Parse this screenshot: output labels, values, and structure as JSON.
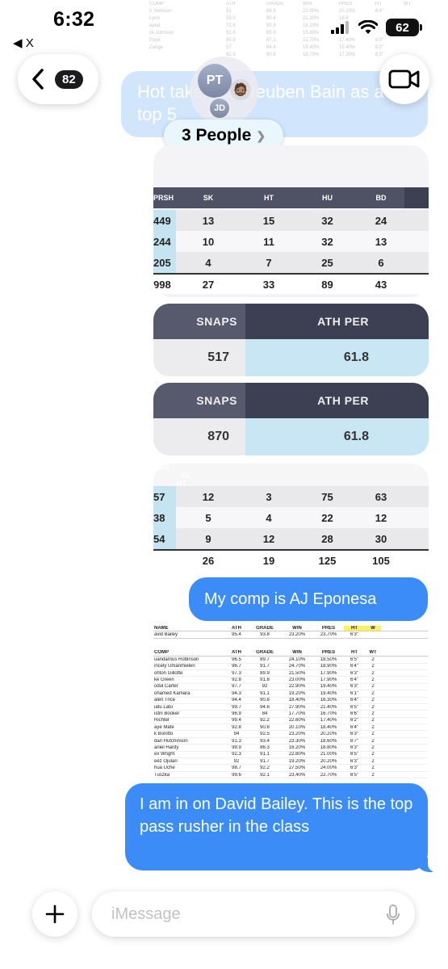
{
  "status_bar": {
    "time": "6:32",
    "back_app": "◀ X",
    "battery": "62"
  },
  "bg_sheet": {
    "header": [
      "COMP",
      "ATH",
      "GRADE",
      "WIN",
      "PRES",
      "HT",
      "WT"
    ],
    "rows": [
      [
        "n Swinson",
        "91",
        "86.3",
        "22.00%",
        "20.10%",
        "6'4\""
      ],
      [
        "Lynn",
        "59.9",
        "90.4",
        "21.30%",
        "18.6",
        ""
      ],
      [
        "ayed",
        "72.8",
        "90.9",
        "16.20%",
        "18.",
        ""
      ],
      [
        "ck Johnson",
        "51.6",
        "85.9",
        "15.80%",
        "",
        ""
      ],
      [
        "Paye",
        "85.9",
        "87.1",
        "21.70%",
        "17.40%",
        "6'3\""
      ],
      [
        "Zarige",
        "57",
        "84.4",
        "18.40%",
        "15.40%",
        "6'2\""
      ],
      [
        "",
        "82.3",
        "90.8",
        "18.70%",
        "17.30%",
        "6'3\""
      ]
    ]
  },
  "nav": {
    "back_count": "82",
    "group_initials_1": "PT",
    "group_initials_2": "JD",
    "group_emoji": "🧔🏽",
    "people_label": "3 People"
  },
  "faded_message": "Hot take... of Reuben Bain as a top 5",
  "stat_table_1": {
    "columns": [
      "PRSH",
      "SK",
      "HT",
      "HU",
      "BD"
    ],
    "rows": [
      [
        "449",
        "13",
        "15",
        "32",
        "24"
      ],
      [
        "244",
        "10",
        "11",
        "32",
        "13"
      ],
      [
        "205",
        "4",
        "7",
        "25",
        "6"
      ],
      [
        "998",
        "27",
        "33",
        "89",
        "43"
      ]
    ]
  },
  "snap_card_1": {
    "snaps_label": "SNAPS",
    "ath_label": "ATH PER",
    "snaps": "517",
    "ath": "61.8"
  },
  "snap_card_2": {
    "snaps_label": "SNAPS",
    "ath_label": "ATH PER",
    "snaps": "870",
    "ath": "61.8"
  },
  "stat_table_2": {
    "columns": [
      "RSH",
      "SK",
      "HT",
      "HU",
      "BD"
    ],
    "rows": [
      [
        "57",
        "12",
        "3",
        "75",
        "63"
      ],
      [
        "38",
        "5",
        "4",
        "22",
        "12"
      ],
      [
        "54",
        "9",
        "12",
        "28",
        "30"
      ],
      [
        "",
        "26",
        "19",
        "125",
        "105"
      ]
    ]
  },
  "messages": {
    "comp": "My comp is AJ Eponesa",
    "final": "I am in on David Bailey. This is the top pass rusher in the class"
  },
  "sheet": {
    "top_header": [
      "NAME",
      "ATH",
      "GRADE",
      "WIN",
      "PRES",
      "HT",
      "W"
    ],
    "top_row": [
      "avid Bailey",
      "95.4",
      "93.8",
      "23.20%",
      "23.70%",
      "6'3\""
    ],
    "comp_header": [
      "COMP",
      "ATH",
      "GRADE",
      "WIN",
      "PRES",
      "HT",
      "WT"
    ],
    "rows": [
      [
        "uandarrius Robinson",
        "96.5",
        "89.7",
        "24.10%",
        "18.50%",
        "6'5\"",
        "2"
      ],
      [
        "incely Umanmielen",
        "96.7",
        "91.7",
        "24.70%",
        "18.90%",
        "6'4\"",
        "2"
      ],
      [
        "ohton Gillotte",
        "97.3",
        "89.9",
        "21.50%",
        "17.90%",
        "6'3\"",
        "2"
      ],
      [
        "ke Green",
        "92.8",
        "91.8",
        "23.00%",
        "17.90%",
        "6'4\"",
        "2"
      ],
      [
        "odul Carter",
        "97.7",
        "92",
        "22.90%",
        "19.40%",
        "6'3\"",
        "2"
      ],
      [
        "ohamed Kamara",
        "94.3",
        "91.1",
        "19.20%",
        "19.40%",
        "6'1\"",
        "2"
      ],
      [
        "alen Trice",
        "94.4",
        "90.8",
        "18.40%",
        "16.30%",
        "6'4\"",
        "2"
      ],
      [
        "iatu Latu",
        "99.7",
        "94.6",
        "27.90%",
        "21.40%",
        "6'5\"",
        "2"
      ],
      [
        "istin Booker",
        "96.9",
        "84",
        "17.70%",
        "16.70%",
        "6'6\"",
        "2"
      ],
      [
        "Richter",
        "99.4",
        "92.2",
        "22.60%",
        "17.40%",
        "6'2\"",
        "2"
      ],
      [
        "aye Mafe",
        "92.8",
        "90.8",
        "20.10%",
        "18.40%",
        "6'4\"",
        "2"
      ],
      [
        "k Bonitto",
        "94",
        "92.5",
        "23.20%",
        "20.20%",
        "6'3\"",
        "2"
      ],
      [
        "dan Hutchinson",
        "91.3",
        "93.4",
        "23.30%",
        "18.60%",
        "6'7\"",
        "2"
      ],
      [
        "aniel Hardy",
        "99.9",
        "86.3",
        "16.20%",
        "18.80%",
        "6'3\"",
        "2"
      ],
      [
        "ex Wright",
        "92.3",
        "91.1",
        "22.80%",
        "21.00%",
        "6'5\"",
        "2"
      ],
      [
        "eez Ojulari",
        "92",
        "91.7",
        "19.20%",
        "20.20%",
        "6'3\"",
        "2"
      ],
      [
        "hua Uche",
        "98.7",
        "92.2",
        "27.50%",
        "24.00%",
        "6'3\"",
        "2"
      ],
      [
        "Tuszka",
        "99.6",
        "92.1",
        "23.40%",
        "22.70%",
        "6'5\"",
        "2"
      ]
    ]
  },
  "compose": {
    "placeholder": "iMessage"
  },
  "colors": {
    "bubble_blue": "#3b8cf7",
    "table_header": "#4f5264",
    "highlight_blue": "#c5e4f2"
  }
}
